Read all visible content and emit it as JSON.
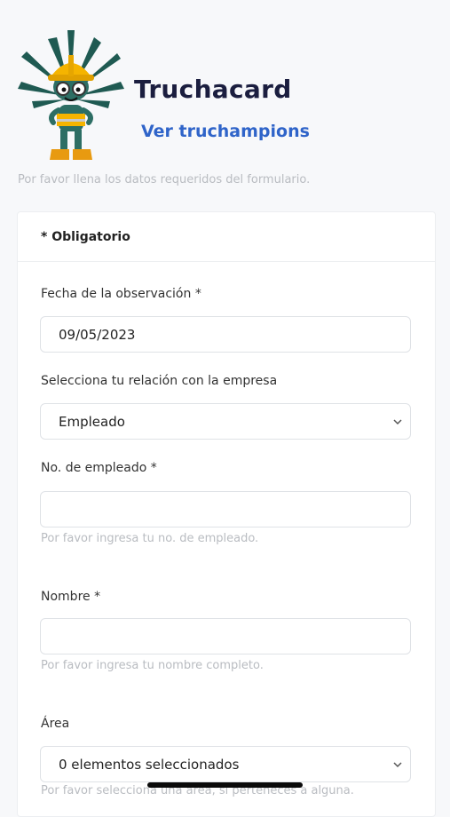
{
  "header": {
    "app_title": "Truchacard",
    "link_label": "Ver truchampions"
  },
  "intro_text": "Por favor llena los datos requeridos del formulario.",
  "form": {
    "required_note": "* Obligatorio",
    "fields": {
      "date": {
        "label": "Fecha de la observación *",
        "value": "09/05/2023"
      },
      "relation": {
        "label": "Selecciona tu relación con la empresa",
        "value": "Empleado"
      },
      "employee_no": {
        "label": "No. de empleado *",
        "value": "",
        "help": "Por favor ingresa tu no. de empleado."
      },
      "name": {
        "label": "Nombre *",
        "value": "",
        "help": "Por favor ingresa tu nombre completo."
      },
      "area": {
        "label": "Área",
        "value": "0 elementos seleccionados",
        "help": "Por favor selecciona una área, si perteneces a alguna."
      }
    }
  },
  "colors": {
    "title": "#1b1e3f",
    "link": "#2f64c9",
    "muted": "#b9bcc1",
    "mascot_leaves": "#1f5a52",
    "helmet": "#f5b400"
  },
  "icons": [
    "mascot-logo",
    "chevron-down-icon"
  ]
}
